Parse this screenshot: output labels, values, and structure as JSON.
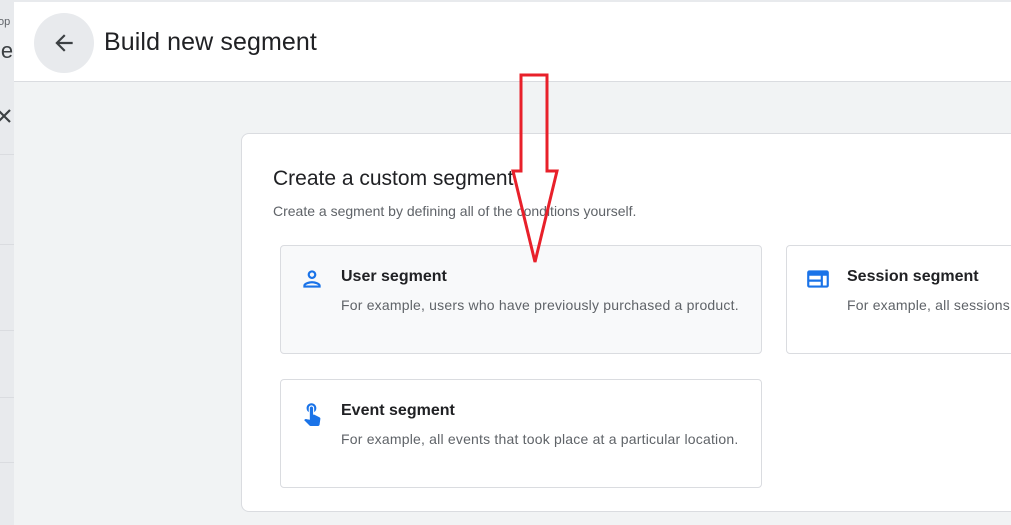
{
  "background": {
    "fragment_small": "op",
    "fragment_large": "le"
  },
  "header": {
    "title": "Build new segment",
    "back_icon": "arrow-back-icon"
  },
  "card": {
    "title": "Create a custom segment",
    "subtitle": "Create a segment by defining all of the conditions yourself."
  },
  "options": {
    "user": {
      "title": "User segment",
      "description": "For example, users who have previously purchased a product.",
      "icon": "person-icon"
    },
    "session": {
      "title": "Session segment",
      "description": "For example, all sessions",
      "icon": "web-icon"
    },
    "event": {
      "title": "Event segment",
      "description": "For example, all events that took place at a particular location.",
      "icon": "touch-icon"
    }
  },
  "colors": {
    "accent": "#1a73e8",
    "annotation_arrow": "#e8202a"
  }
}
